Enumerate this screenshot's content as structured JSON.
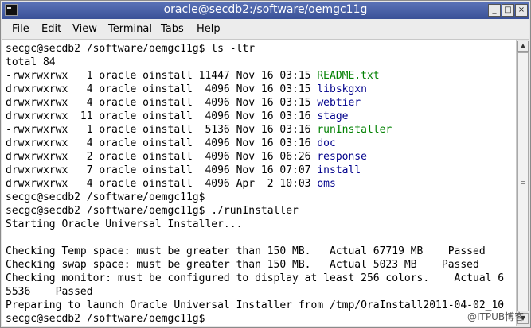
{
  "window": {
    "title": "oracle@secdb2:/software/oemgc11g",
    "minimize_glyph": "_",
    "maximize_glyph": "□",
    "close_glyph": "×"
  },
  "menu": {
    "items": [
      "File",
      "Edit",
      "View",
      "Terminal",
      "Tabs",
      "Help"
    ]
  },
  "terminal": {
    "colors": {
      "text": "#000000",
      "filename_plain": "#00008b",
      "filename_exec": "#008000"
    },
    "lines": [
      {
        "text": "secgc@secdb2 /software/oemgc11g$ ls -ltr"
      },
      {
        "text": "total 84"
      },
      {
        "prefix": "-rwxrwxrwx   1 oracle oinstall 11447 Nov 16 03:15 ",
        "file": "README.txt",
        "color": "#008000"
      },
      {
        "prefix": "drwxrwxrwx   4 oracle oinstall  4096 Nov 16 03:15 ",
        "file": "libskgxn",
        "color": "#00008b"
      },
      {
        "prefix": "drwxrwxrwx   4 oracle oinstall  4096 Nov 16 03:15 ",
        "file": "webtier",
        "color": "#00008b"
      },
      {
        "prefix": "drwxrwxrwx  11 oracle oinstall  4096 Nov 16 03:16 ",
        "file": "stage",
        "color": "#00008b"
      },
      {
        "prefix": "-rwxrwxrwx   1 oracle oinstall  5136 Nov 16 03:16 ",
        "file": "runInstaller",
        "color": "#008000"
      },
      {
        "prefix": "drwxrwxrwx   4 oracle oinstall  4096 Nov 16 03:16 ",
        "file": "doc",
        "color": "#00008b"
      },
      {
        "prefix": "drwxrwxrwx   2 oracle oinstall  4096 Nov 16 06:26 ",
        "file": "response",
        "color": "#00008b"
      },
      {
        "prefix": "drwxrwxrwx   7 oracle oinstall  4096 Nov 16 07:07 ",
        "file": "install",
        "color": "#00008b"
      },
      {
        "prefix": "drwxrwxrwx   4 oracle oinstall  4096 Apr  2 10:03 ",
        "file": "oms",
        "color": "#00008b"
      },
      {
        "text": "secgc@secdb2 /software/oemgc11g$"
      },
      {
        "text": "secgc@secdb2 /software/oemgc11g$ ./runInstaller"
      },
      {
        "text": "Starting Oracle Universal Installer..."
      },
      {
        "text": ""
      },
      {
        "text": "Checking Temp space: must be greater than 150 MB.   Actual 67719 MB    Passed"
      },
      {
        "text": "Checking swap space: must be greater than 150 MB.   Actual 5023 MB    Passed"
      },
      {
        "text": "Checking monitor: must be configured to display at least 256 colors.    Actual 6"
      },
      {
        "text": "5536    Passed"
      },
      {
        "text": "Preparing to launch Oracle Universal Installer from /tmp/OraInstall2011-04-02_10"
      },
      {
        "text": "secgc@secdb2 /software/oemgc11g$"
      }
    ]
  },
  "watermark": "@ITPUB博客"
}
